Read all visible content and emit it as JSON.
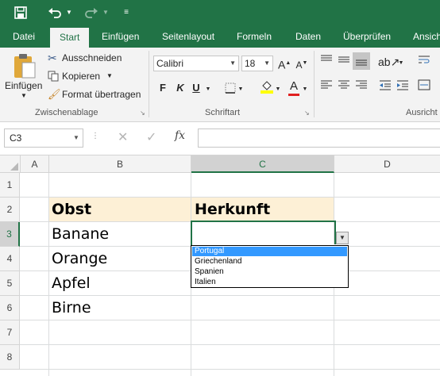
{
  "quick_access": {
    "save_icon": "save-icon",
    "undo_icon": "undo-icon",
    "redo_icon": "redo-icon",
    "customize_icon": "customize-qat-icon"
  },
  "tabs": [
    "Datei",
    "Start",
    "Einfügen",
    "Seitenlayout",
    "Formeln",
    "Daten",
    "Überprüfen",
    "Ansicht"
  ],
  "active_tab": "Start",
  "ribbon": {
    "clipboard": {
      "paste_label": "Einfügen",
      "cut_label": "Ausschneiden",
      "copy_label": "Kopieren",
      "format_painter_label": "Format übertragen",
      "group_label": "Zwischenablage"
    },
    "font": {
      "font_name": "Calibri",
      "font_size": "18",
      "grow_label": "A",
      "shrink_label": "A",
      "bold_label": "F",
      "italic_label": "K",
      "underline_label": "U",
      "font_color_label": "A",
      "group_label": "Schriftart"
    },
    "alignment": {
      "group_label": "Ausricht"
    }
  },
  "formula_bar": {
    "name_box": "C3",
    "fx_label": "fx",
    "formula": ""
  },
  "columns": [
    "A",
    "B",
    "C",
    "D"
  ],
  "selected_column": "C",
  "rows": [
    "1",
    "2",
    "3",
    "4",
    "5",
    "6",
    "7",
    "8"
  ],
  "selected_row": "3",
  "cells": {
    "B2": "Obst",
    "C2": "Herkunft",
    "B3": "Banane",
    "B4": "Orange",
    "B5": "Apfel",
    "B6": "Birne"
  },
  "header_fill_color": "#fdf0d6",
  "accent_color": "#217346",
  "dropdown": {
    "options": [
      "Portugal",
      "Griechenland",
      "Spanien",
      "Italien"
    ],
    "highlighted": "Portugal"
  }
}
